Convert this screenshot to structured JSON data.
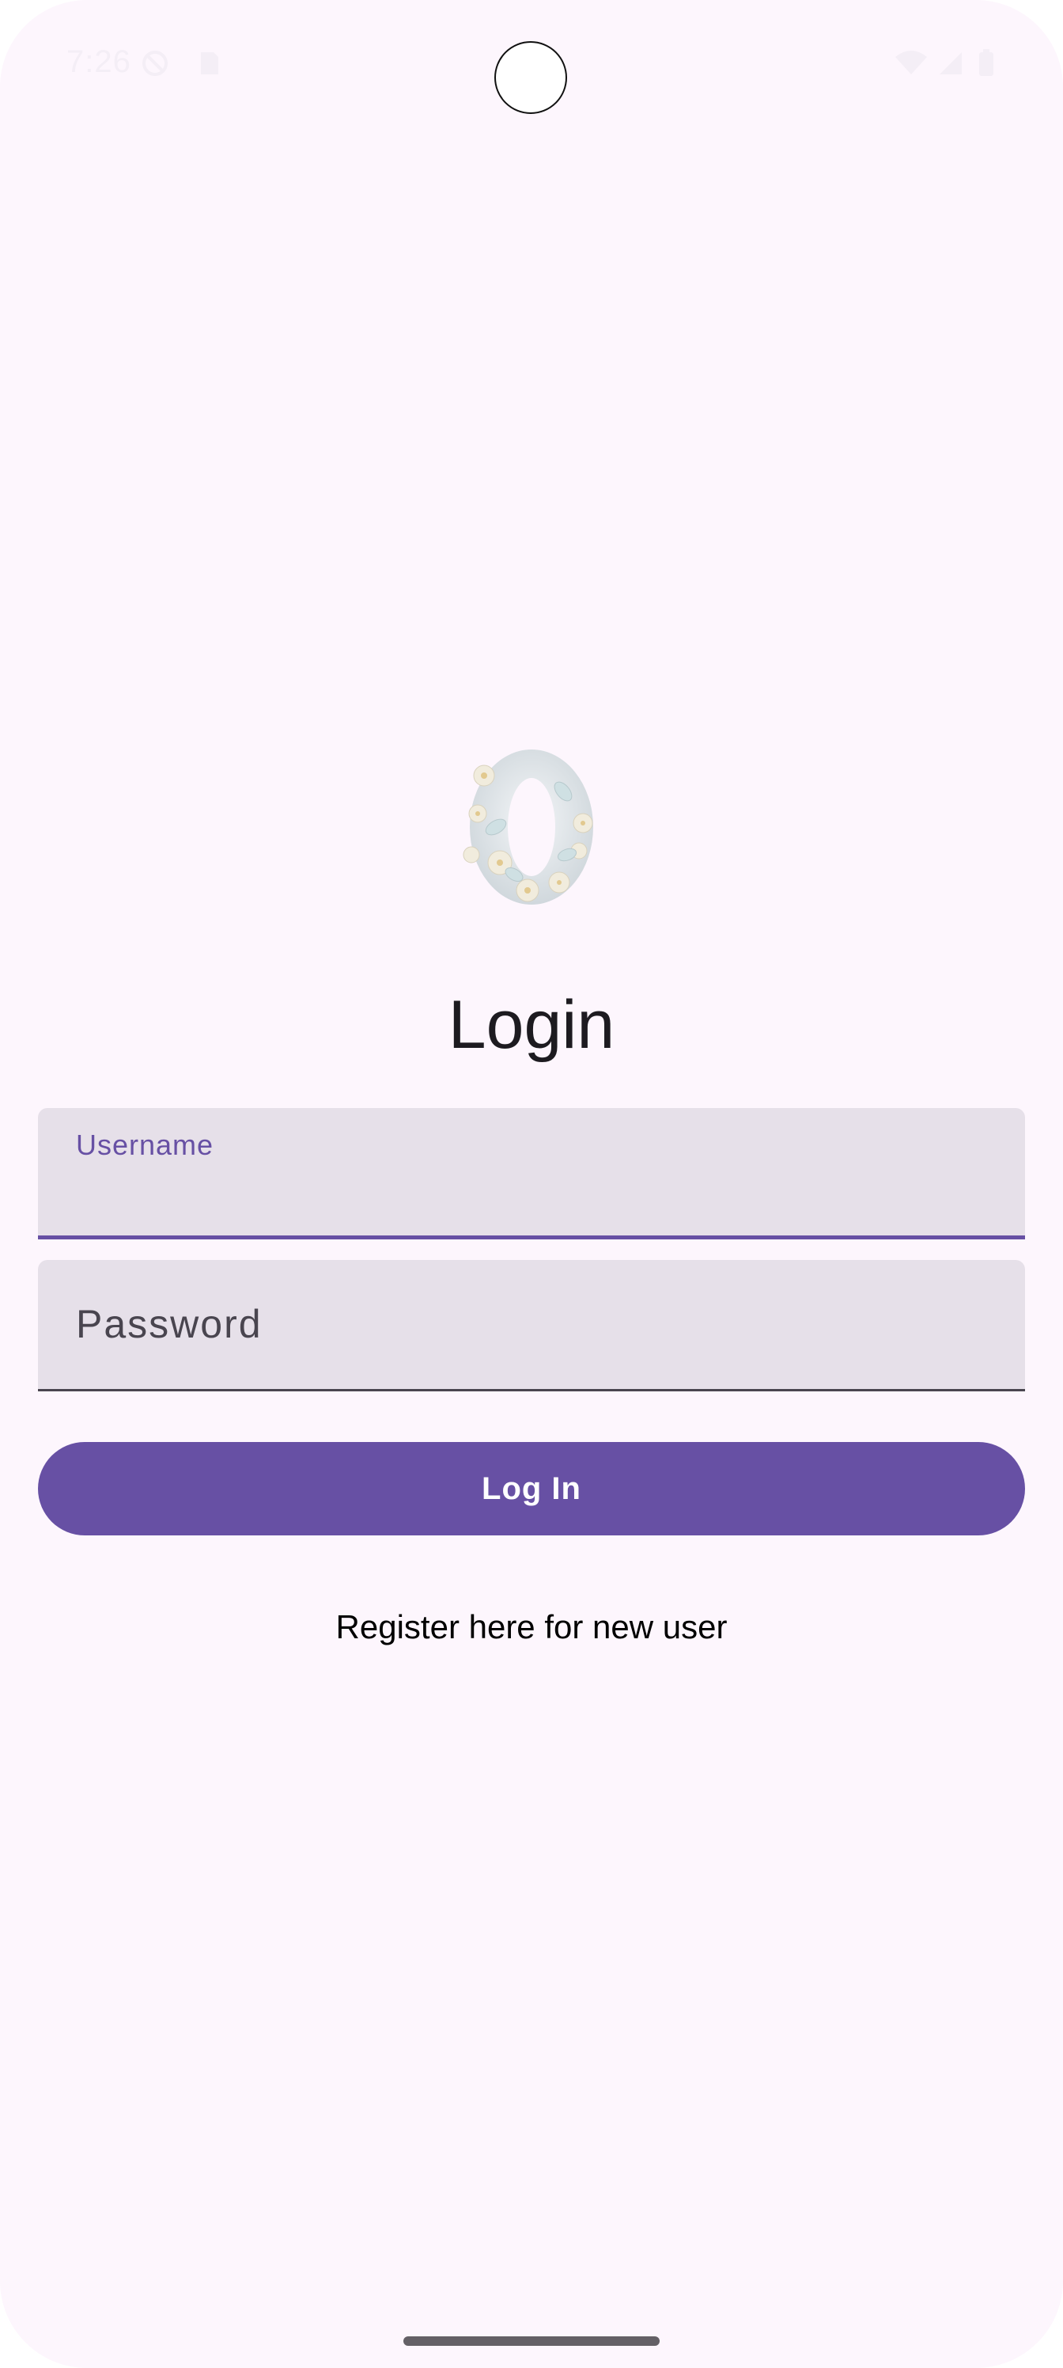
{
  "status_bar": {
    "time": "7:26",
    "icons": [
      "do-not-disturb-icon",
      "sim-card-icon",
      "wifi-icon",
      "signal-icon",
      "battery-icon"
    ]
  },
  "logo": {
    "icon": "floral-zero-logo-icon"
  },
  "login": {
    "title": "Login",
    "username_label": "Username",
    "username_value": "",
    "password_label": "Password",
    "password_value": "",
    "login_button_label": "Log In",
    "register_link_label": "Register here for new user"
  },
  "colors": {
    "primary": "#6750a4",
    "background": "#fdf6fd",
    "field_fill": "#e6e0e9",
    "text_primary": "#1d1b20"
  }
}
